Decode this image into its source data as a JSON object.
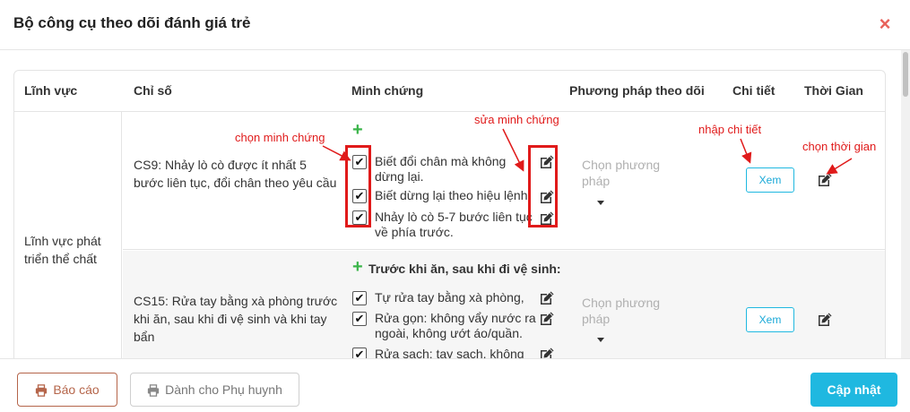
{
  "modal": {
    "title": "Bộ công cụ theo dõi đánh giá trẻ",
    "close_label": "×"
  },
  "table": {
    "headers": {
      "linh_vuc": "Lĩnh vực",
      "chi_so": "Chỉ số",
      "minh_chung": "Minh chứng",
      "phuong_phap": "Phương pháp theo dõi",
      "chi_tiet": "Chi tiết",
      "thoi_gian": "Thời Gian"
    },
    "linh_vuc": "Lĩnh vực phát triển thể chất",
    "rows": [
      {
        "chi_so": "CS9: Nhảy lò cò được ít nhất 5 bước liên tục, đổi chân theo yêu cầu",
        "plus": "+",
        "evidence": [
          {
            "text": "Biết đổi chân mà không dừng lại.",
            "checked": true
          },
          {
            "text": "Biết dừng lại theo hiệu lệnh.",
            "checked": true
          },
          {
            "text": "Nhảy lò cò 5-7 bước liên tục về phía trước.",
            "checked": true
          }
        ],
        "phuong_phap_placeholder": "Chọn phương pháp",
        "xem_label": "Xem"
      },
      {
        "chi_so": "CS15: Rửa tay bằng xà phòng trước khi ăn, sau khi đi vệ sinh và khi tay bẩn",
        "plus": "+",
        "group_title": "Trước khi ăn, sau khi đi vệ sinh:",
        "evidence": [
          {
            "text": "Tự rửa tay bằng xà phòng,",
            "checked": true
          },
          {
            "text": "Rửa gọn: không vẩy nước ra ngoài, không ướt áo/quần.",
            "checked": true
          },
          {
            "text": "Rửa sạch: tay sạch, không",
            "checked": true
          }
        ],
        "phuong_phap_placeholder": "Chọn phương pháp",
        "xem_label": "Xem"
      }
    ]
  },
  "annotations": {
    "chon_minh_chung": "chọn minh chứng",
    "sua_minh_chung": "sửa minh chứng",
    "nhap_chi_tiet": "nhập chi tiết",
    "chon_thoi_gian": "chọn thời gian"
  },
  "footer": {
    "bao_cao": "Báo cáo",
    "phu_huynh": "Dành cho Phụ huynh",
    "cap_nhat": "Cập nhật"
  },
  "colors": {
    "accent": "#1fb8e0",
    "annotation": "#e01a1a",
    "plus": "#3bb54a",
    "close": "#e8625a",
    "bao_cao": "#b5654a"
  },
  "icons": {
    "close": "close-icon",
    "plus": "plus-icon",
    "edit": "edit-icon",
    "check": "checkmark-icon",
    "printer": "printer-icon",
    "caret": "caret-down-icon"
  }
}
